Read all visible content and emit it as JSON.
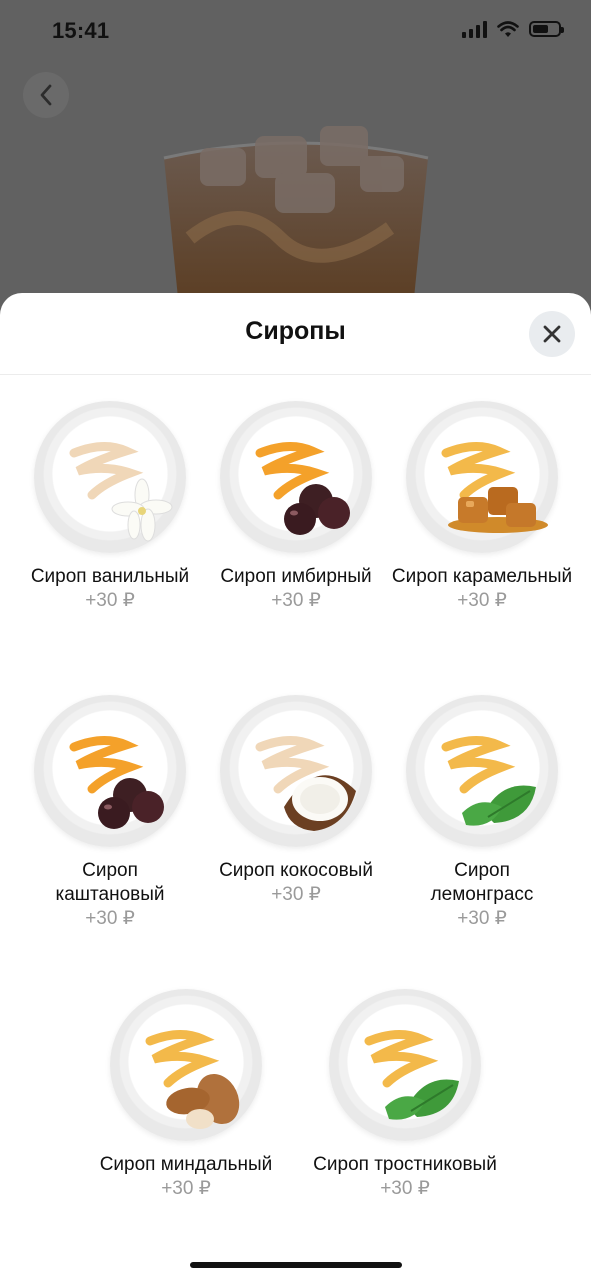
{
  "status_bar": {
    "time": "15:41"
  },
  "sheet": {
    "title": "Сиропы"
  },
  "syrups": [
    {
      "name": "Сироп ванильный",
      "price": "+30 ₽",
      "addon": "vanilla-flower"
    },
    {
      "name": "Сироп имбирный",
      "price": "+30 ₽",
      "addon": "plums"
    },
    {
      "name": "Сироп карамельный",
      "price": "+30 ₽",
      "addon": "caramel"
    },
    {
      "name": "Сироп каштановый",
      "price": "+30 ₽",
      "addon": "plums"
    },
    {
      "name": "Сироп кокосовый",
      "price": "+30 ₽",
      "addon": "coconut"
    },
    {
      "name": "Сироп лемонграсс",
      "price": "+30 ₽",
      "addon": "mint"
    },
    {
      "name": "Сироп миндальный",
      "price": "+30 ₽",
      "addon": "almonds"
    },
    {
      "name": "Сироп тростниковый",
      "price": "+30 ₽",
      "addon": "mint"
    }
  ],
  "colors": {
    "syrup_vanilla": "#f0d7b8",
    "syrup_orange": "#f4a12a",
    "syrup_gold": "#f3b94a"
  }
}
